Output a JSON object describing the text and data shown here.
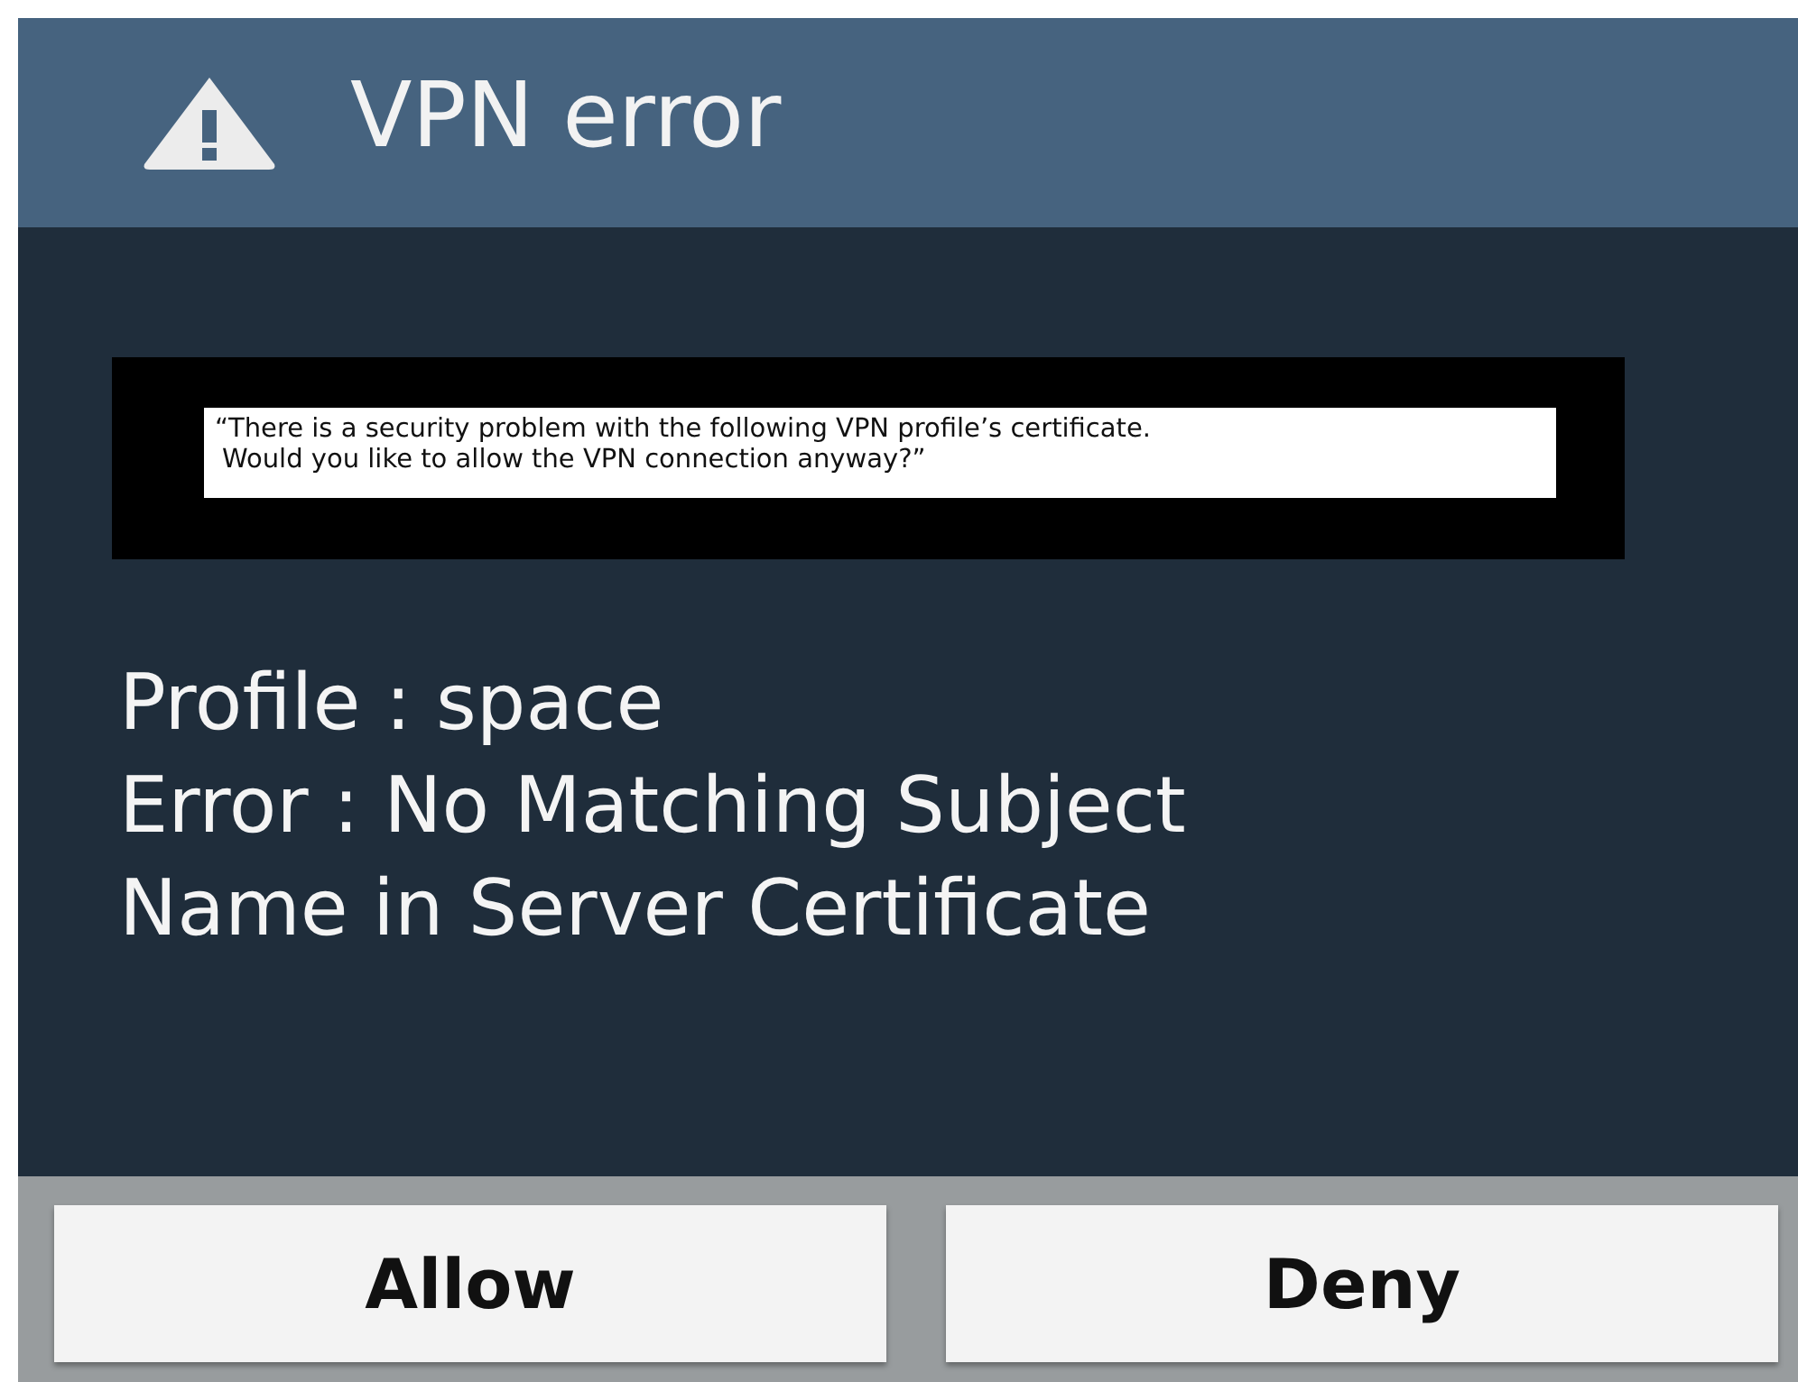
{
  "dialog": {
    "title": "VPN error"
  },
  "notice": {
    "lines": [
      "“There is a security problem with the following VPN profile’s certificate.",
      "Would you like to allow the VPN connection anyway?”"
    ]
  },
  "details": [
    "Profile : space",
    "Error : No Matching Subject",
    "Name in Server Certificate"
  ],
  "buttons": [
    "Allow",
    "Deny"
  ]
}
